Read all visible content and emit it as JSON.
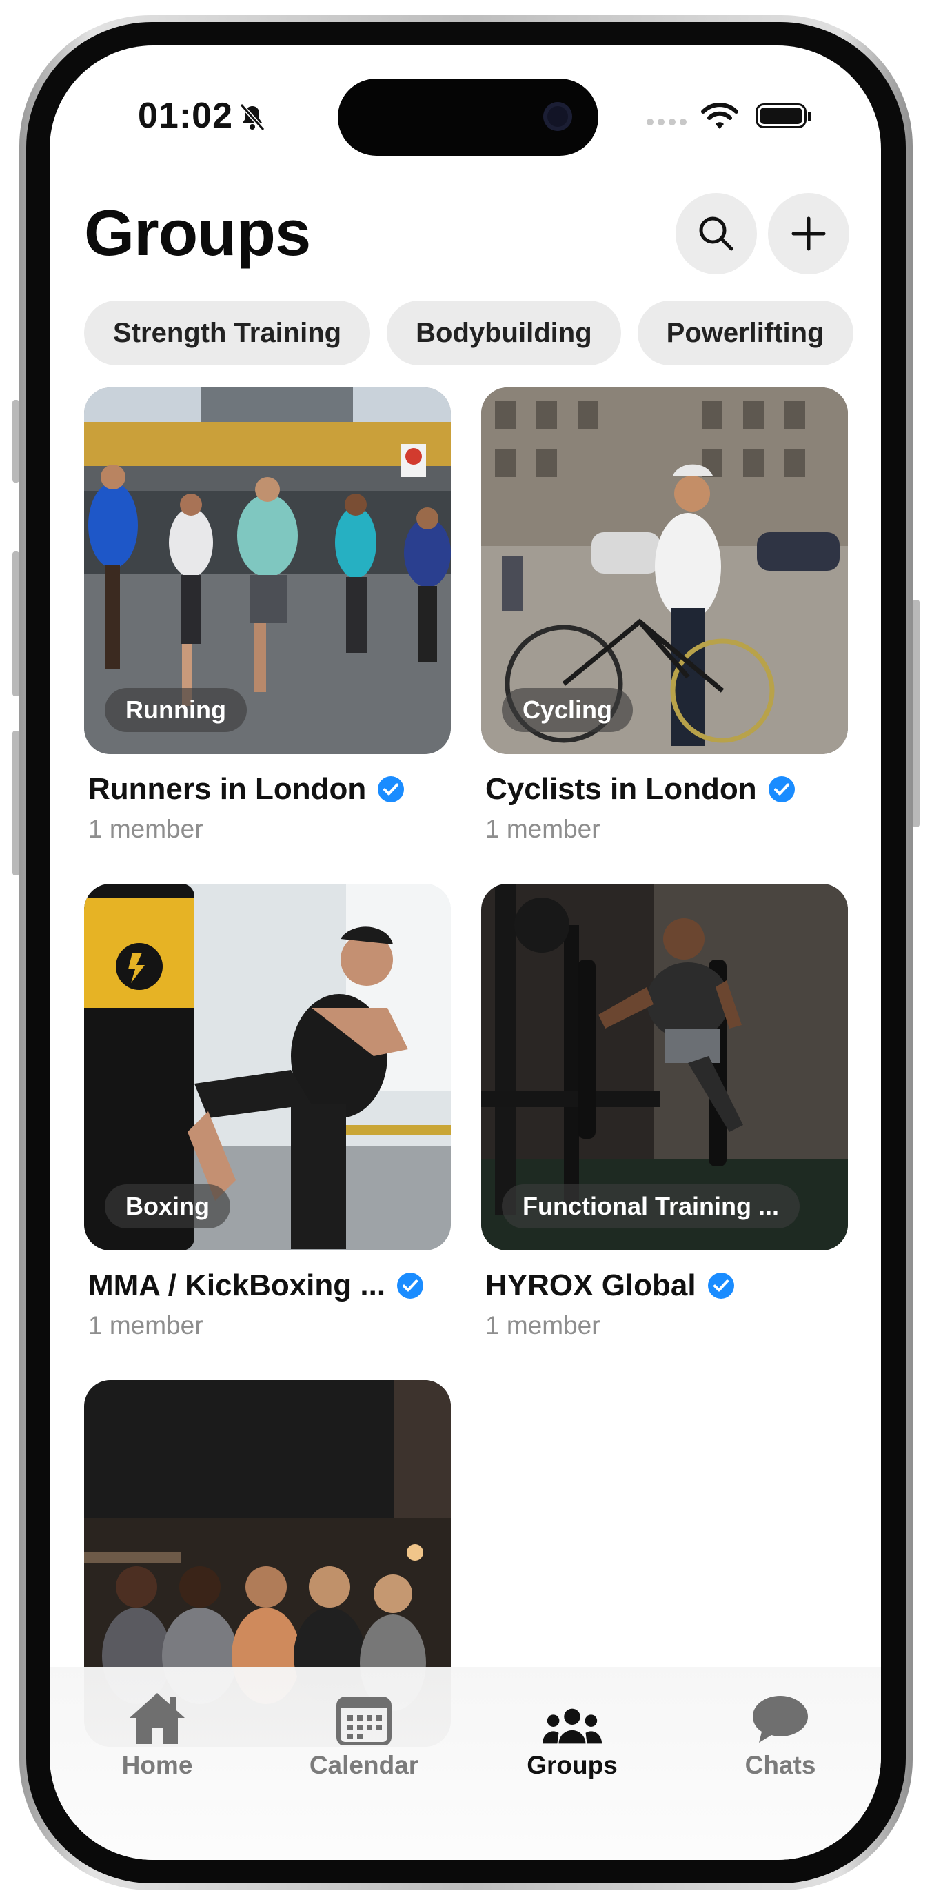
{
  "status_bar": {
    "time": "01:02"
  },
  "header": {
    "title": "Groups"
  },
  "filters": [
    "Strength Training",
    "Bodybuilding",
    "Powerlifting"
  ],
  "groups": [
    {
      "name": "Runners in London",
      "members": "1 member",
      "tag": "Running",
      "verified": true
    },
    {
      "name": "Cyclists in London",
      "members": "1 member",
      "tag": "Cycling",
      "verified": true
    },
    {
      "name": "MMA / KickBoxing ...",
      "members": "1 member",
      "tag": "Boxing",
      "verified": true
    },
    {
      "name": "HYROX Global",
      "members": "1 member",
      "tag": "Functional Training  ...",
      "verified": true
    },
    {
      "name": "",
      "members": "",
      "tag": "",
      "verified": false
    }
  ],
  "tabbar": {
    "items": [
      {
        "label": "Home",
        "icon": "house-icon"
      },
      {
        "label": "Calendar",
        "icon": "calendar-icon"
      },
      {
        "label": "Groups",
        "icon": "people-icon"
      },
      {
        "label": "Chats",
        "icon": "chat-bubble-icon"
      }
    ],
    "active": "Groups"
  },
  "colors": {
    "verified": "#1a8cff",
    "chip_bg": "#ebebeb",
    "muted": "#8e8e8e"
  }
}
